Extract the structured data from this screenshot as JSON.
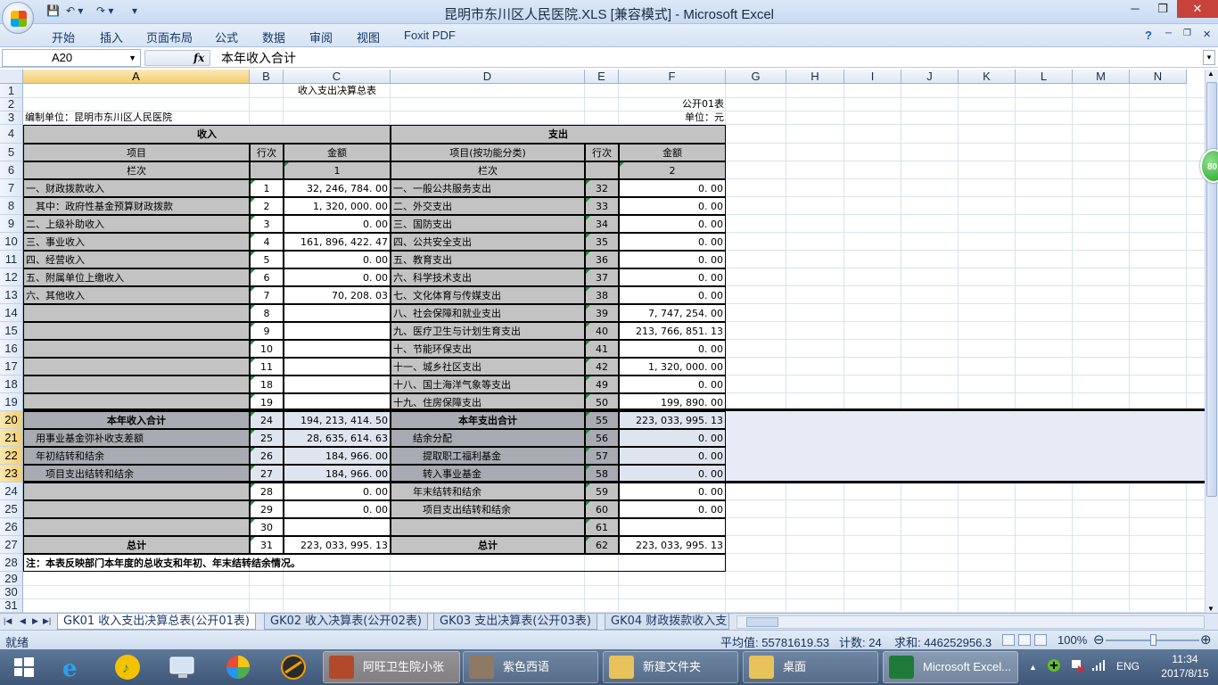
{
  "window": {
    "title": "昆明市东川区人民医院.XLS  [兼容模式] - Microsoft Excel",
    "minimize": "─",
    "restore": "❐",
    "close": "✕"
  },
  "qat": {
    "save": "💾",
    "undo": "↶ ▾",
    "redo": "↷ ▾",
    "more": "▾"
  },
  "menu": [
    "开始",
    "插入",
    "页面布局",
    "公式",
    "数据",
    "审阅",
    "视图",
    "Foxit PDF"
  ],
  "menu_right": {
    "help": "?",
    "min": "─",
    "restore": "❐",
    "close": "✕"
  },
  "formula_bar": {
    "name_box": "A20",
    "fx": "fx",
    "content": "本年收入合计"
  },
  "columns": [
    "A",
    "B",
    "C",
    "D",
    "E",
    "F",
    "G",
    "H",
    "I",
    "J",
    "K",
    "L",
    "M",
    "N"
  ],
  "selected_column": "A",
  "rows": [
    "1",
    "2",
    "3",
    "4",
    "5",
    "6",
    "7",
    "8",
    "9",
    "10",
    "11",
    "12",
    "13",
    "14",
    "15",
    "16",
    "17",
    "18",
    "19",
    "20",
    "21",
    "22",
    "23",
    "24",
    "25",
    "26",
    "27",
    "28",
    "29",
    "30",
    "31",
    "32"
  ],
  "sheet": {
    "title": "收入支出决算总表",
    "form_id": "公开01表",
    "unit": "单位：元",
    "org": "编制单位：昆明市东川区人民医院",
    "income_header": "收入",
    "expense_header": "支出",
    "item_label": "项目",
    "line_label": "行次",
    "amount_label": "金额",
    "item_func_label": "项目(按功能分类)",
    "col_label": "栏次",
    "col1": "1",
    "col2": "2",
    "data_rows": [
      {
        "a": "一、财政拨款收入",
        "b": "1",
        "c": "32, 246, 784. 00",
        "d": "一、一般公共服务支出",
        "e": "32",
        "f": "0. 00"
      },
      {
        "a": "　其中：政府性基金预算财政拨款",
        "b": "2",
        "c": "1, 320, 000. 00",
        "d": "二、外交支出",
        "e": "33",
        "f": "0. 00"
      },
      {
        "a": "二、上级补助收入",
        "b": "3",
        "c": "0. 00",
        "d": "三、国防支出",
        "e": "34",
        "f": "0. 00"
      },
      {
        "a": "三、事业收入",
        "b": "4",
        "c": "161, 896, 422. 47",
        "d": "四、公共安全支出",
        "e": "35",
        "f": "0. 00"
      },
      {
        "a": "四、经营收入",
        "b": "5",
        "c": "0. 00",
        "d": "五、教育支出",
        "e": "36",
        "f": "0. 00"
      },
      {
        "a": "五、附属单位上缴收入",
        "b": "6",
        "c": "0. 00",
        "d": "六、科学技术支出",
        "e": "37",
        "f": "0. 00"
      },
      {
        "a": "六、其他收入",
        "b": "7",
        "c": "70, 208. 03",
        "d": "七、文化体育与传媒支出",
        "e": "38",
        "f": "0. 00"
      },
      {
        "a": "",
        "b": "8",
        "c": "",
        "d": "八、社会保障和就业支出",
        "e": "39",
        "f": "7, 747, 254. 00"
      },
      {
        "a": "",
        "b": "9",
        "c": "",
        "d": "九、医疗卫生与计划生育支出",
        "e": "40",
        "f": "213, 766, 851. 13"
      },
      {
        "a": "",
        "b": "10",
        "c": "",
        "d": "十、节能环保支出",
        "e": "41",
        "f": "0. 00"
      },
      {
        "a": "",
        "b": "11",
        "c": "",
        "d": "十一、城乡社区支出",
        "e": "42",
        "f": "1, 320, 000. 00"
      },
      {
        "a": "",
        "b": "18",
        "c": "",
        "d": "十八、国土海洋气象等支出",
        "e": "49",
        "f": "0. 00"
      },
      {
        "a": "",
        "b": "19",
        "c": "",
        "d": "十九、住房保障支出",
        "e": "50",
        "f": "199, 890. 00"
      }
    ],
    "summary_rows": [
      {
        "a": "本年收入合计",
        "b": "24",
        "c": "194, 213, 414. 50",
        "d": "本年支出合计",
        "e": "55",
        "f": "223, 033, 995. 13"
      },
      {
        "a": "　用事业基金弥补收支差额",
        "b": "25",
        "c": "28, 635, 614. 63",
        "d": "　　结余分配",
        "e": "56",
        "f": "0. 00"
      },
      {
        "a": "　年初结转和结余",
        "b": "26",
        "c": "184, 966. 00",
        "d": "　　　提取职工福利基金",
        "e": "57",
        "f": "0. 00"
      },
      {
        "a": "　　项目支出结转和结余",
        "b": "27",
        "c": "184, 966. 00",
        "d": "　　　转入事业基金",
        "e": "58",
        "f": "0. 00"
      },
      {
        "a": "",
        "b": "28",
        "c": "0. 00",
        "d": "　　年末结转和结余",
        "e": "59",
        "f": "0. 00"
      },
      {
        "a": "",
        "b": "29",
        "c": "0. 00",
        "d": "　　　项目支出结转和结余",
        "e": "60",
        "f": "0. 00"
      },
      {
        "a": "",
        "b": "30",
        "c": "",
        "d": "",
        "e": "61",
        "f": ""
      },
      {
        "a": "总计",
        "b": "31",
        "c": "223, 033, 995. 13",
        "d": "总计",
        "e": "62",
        "f": "223, 033, 995. 13"
      }
    ],
    "note": "注：本表反映部门本年度的总收支和年初、年末结转结余情况。"
  },
  "green_badge": "80",
  "sheet_nav": [
    "|◀",
    "◀",
    "▶",
    "▶|"
  ],
  "sheet_tabs": [
    "GK01 收入支出决算总表(公开01表)",
    "GK02 收入决算表(公开02表)",
    "GK03 支出决算表(公开03表)",
    "GK04 财政拨款收入支"
  ],
  "status": {
    "ready": "就绪",
    "average": "平均值: 55781619.53",
    "count": "计数: 24",
    "sum": "求和: 446252956.3",
    "zoom": "100%",
    "zoom_minus": "⊖",
    "zoom_plus": "⊕"
  },
  "taskbar": {
    "buttons": [
      {
        "label": "阿旺卫生院小张"
      },
      {
        "label": "紫色西语"
      },
      {
        "label": "新建文件夹"
      },
      {
        "label": "桌面"
      },
      {
        "label": "Microsoft Excel..."
      }
    ],
    "tray_lang": "ENG",
    "tray_up": "▲",
    "time": "11:34",
    "date": "2017/8/15"
  }
}
